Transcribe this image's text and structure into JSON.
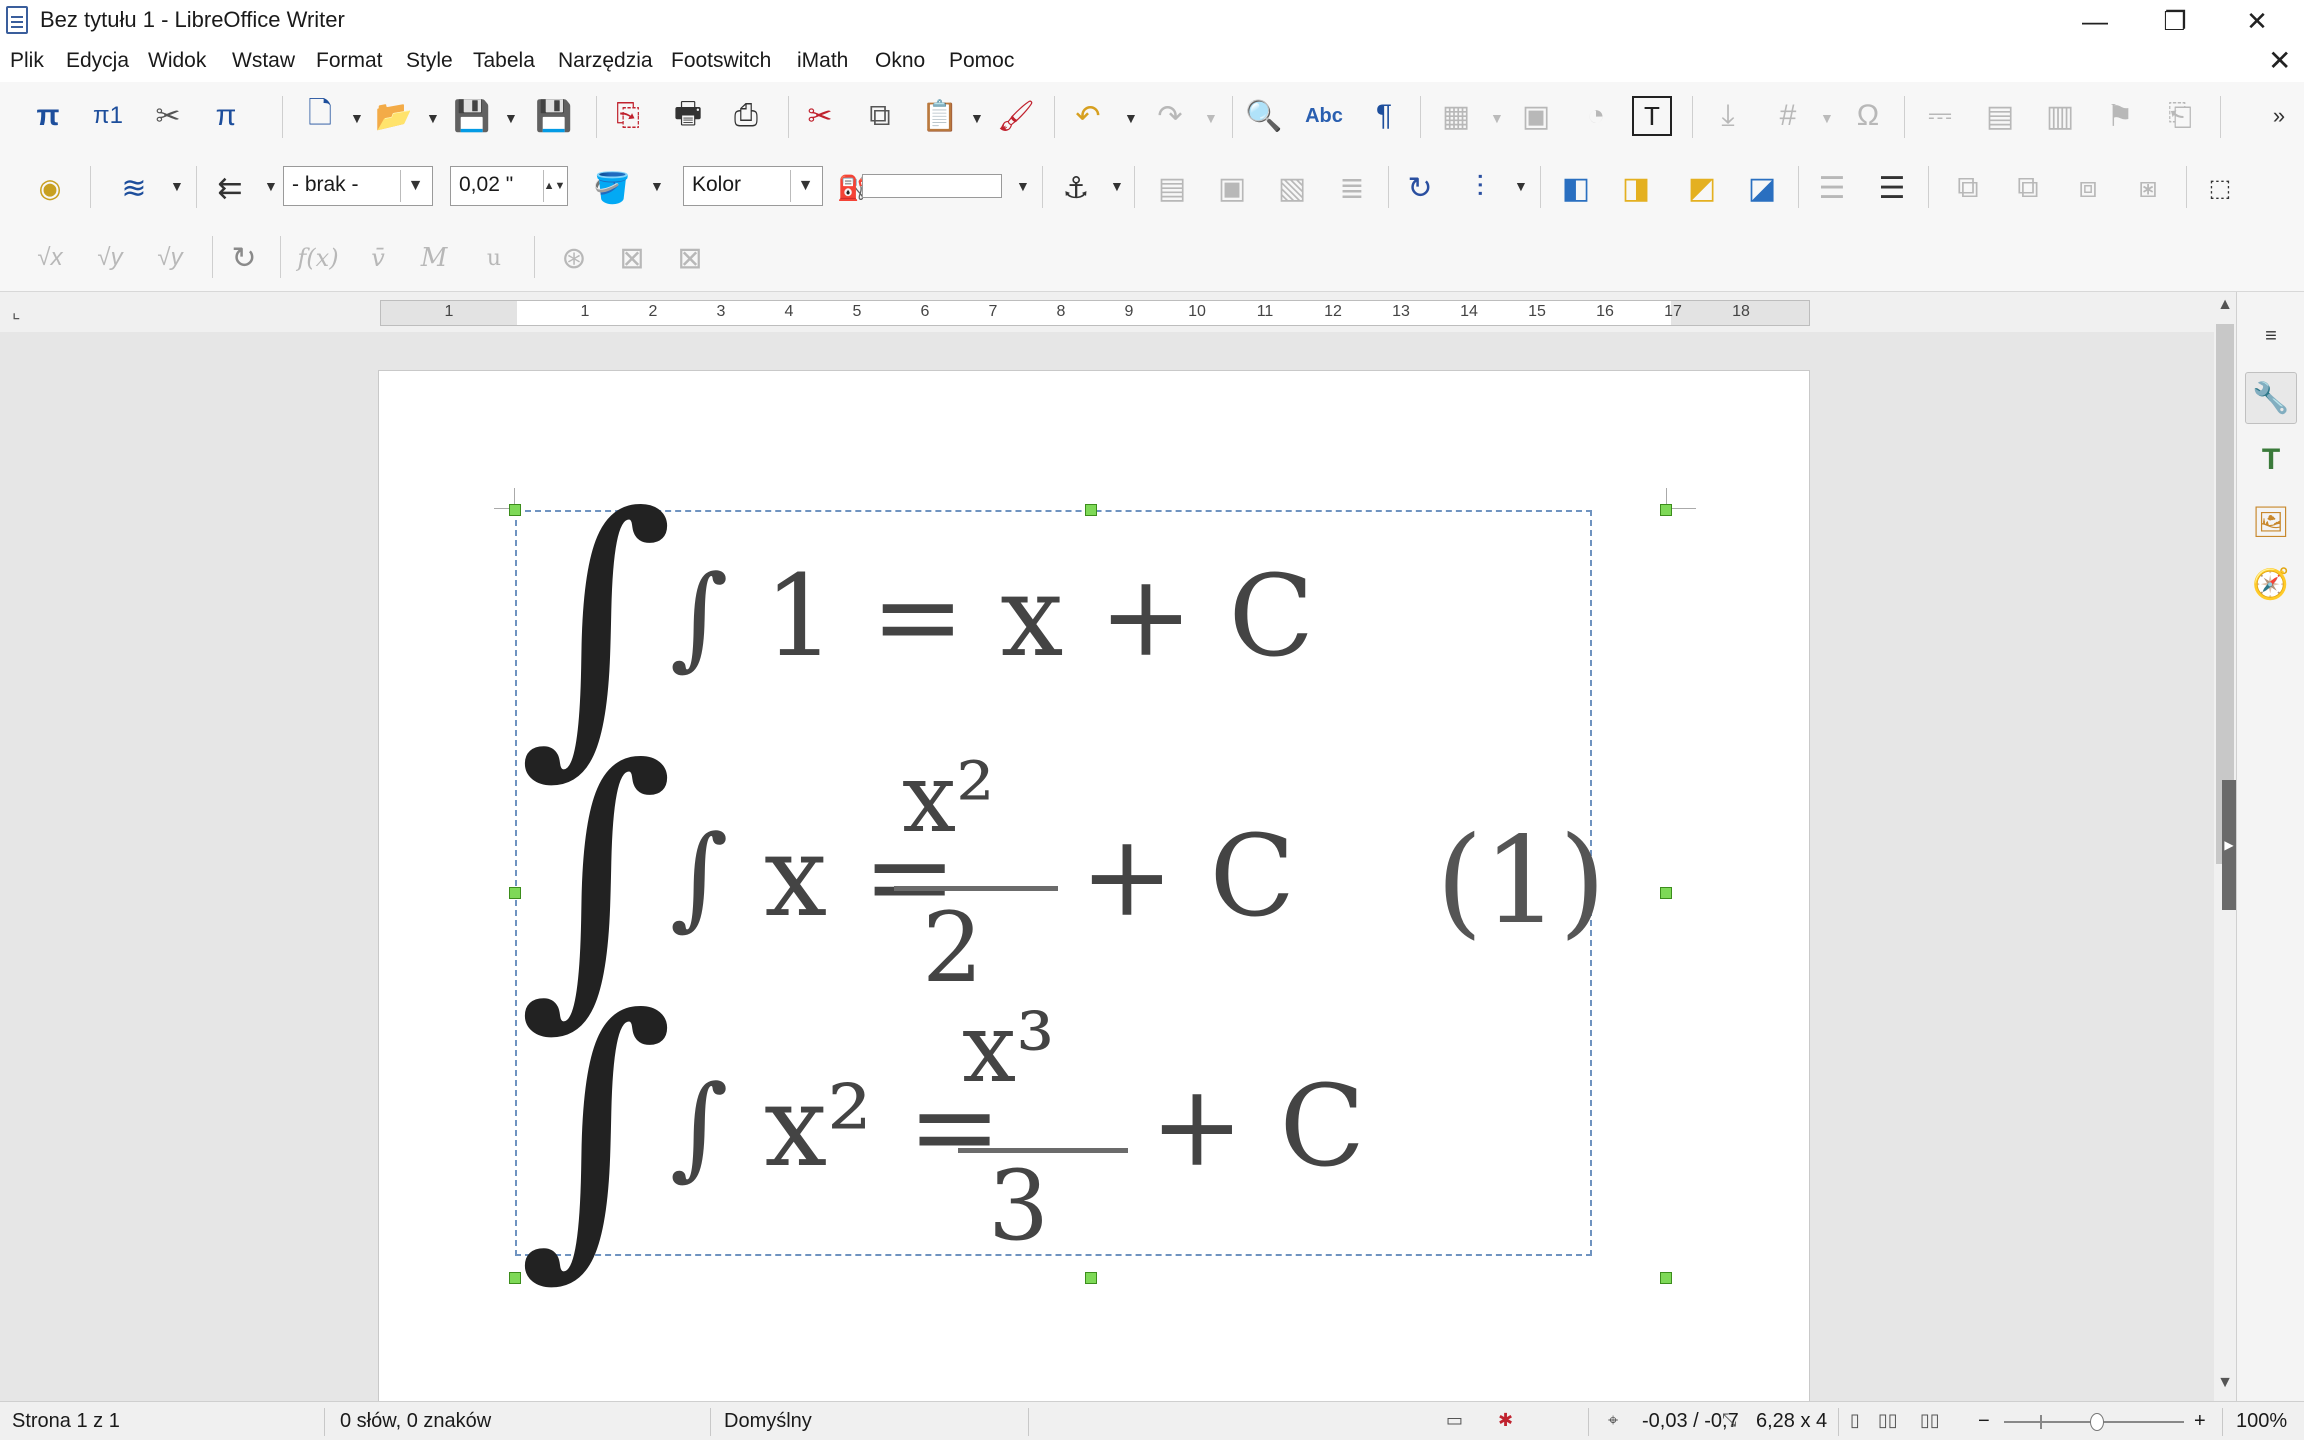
{
  "window": {
    "title": "Bez tytułu 1 - LibreOffice Writer"
  },
  "menu": [
    {
      "label": "Plik"
    },
    {
      "label": "Edycja"
    },
    {
      "label": "Widok"
    },
    {
      "label": "Wstaw"
    },
    {
      "label": "Format"
    },
    {
      "label": "Style"
    },
    {
      "label": "Tabela"
    },
    {
      "label": "Narzędzia"
    },
    {
      "label": "Footswitch"
    },
    {
      "label": "iMath"
    },
    {
      "label": "Okno"
    },
    {
      "label": "Pomoc"
    }
  ],
  "frame_toolbar": {
    "line_style_value": "- brak -",
    "line_width_value": "0,02 \"",
    "area_style_value": "Kolor"
  },
  "ruler": {
    "labels": [
      "1",
      "1",
      "2",
      "3",
      "4",
      "5",
      "6",
      "7",
      "8",
      "9",
      "10",
      "11",
      "12",
      "13",
      "14",
      "15",
      "16",
      "17",
      "18"
    ]
  },
  "formula": {
    "line1": "∫ 1 = x + C",
    "line2_left": "∫ x = ",
    "line2_num": "x²",
    "line2_den": "2",
    "line2_tail": "+ C",
    "line3_left": "∫ x² = ",
    "line3_num": "x³",
    "line3_den": "3",
    "line3_tail": "+ C",
    "equation_number": "(1)"
  },
  "status": {
    "page": "Strona 1 z 1",
    "words": "0 słów, 0 znaków",
    "style": "Domyślny",
    "position": "-0,03 / -0,7",
    "size": "6,28 x 4",
    "zoom": "100%"
  },
  "colors": {
    "accent": "#1d4e9c",
    "handle": "#7ed957",
    "frame": "#6f93c0"
  }
}
